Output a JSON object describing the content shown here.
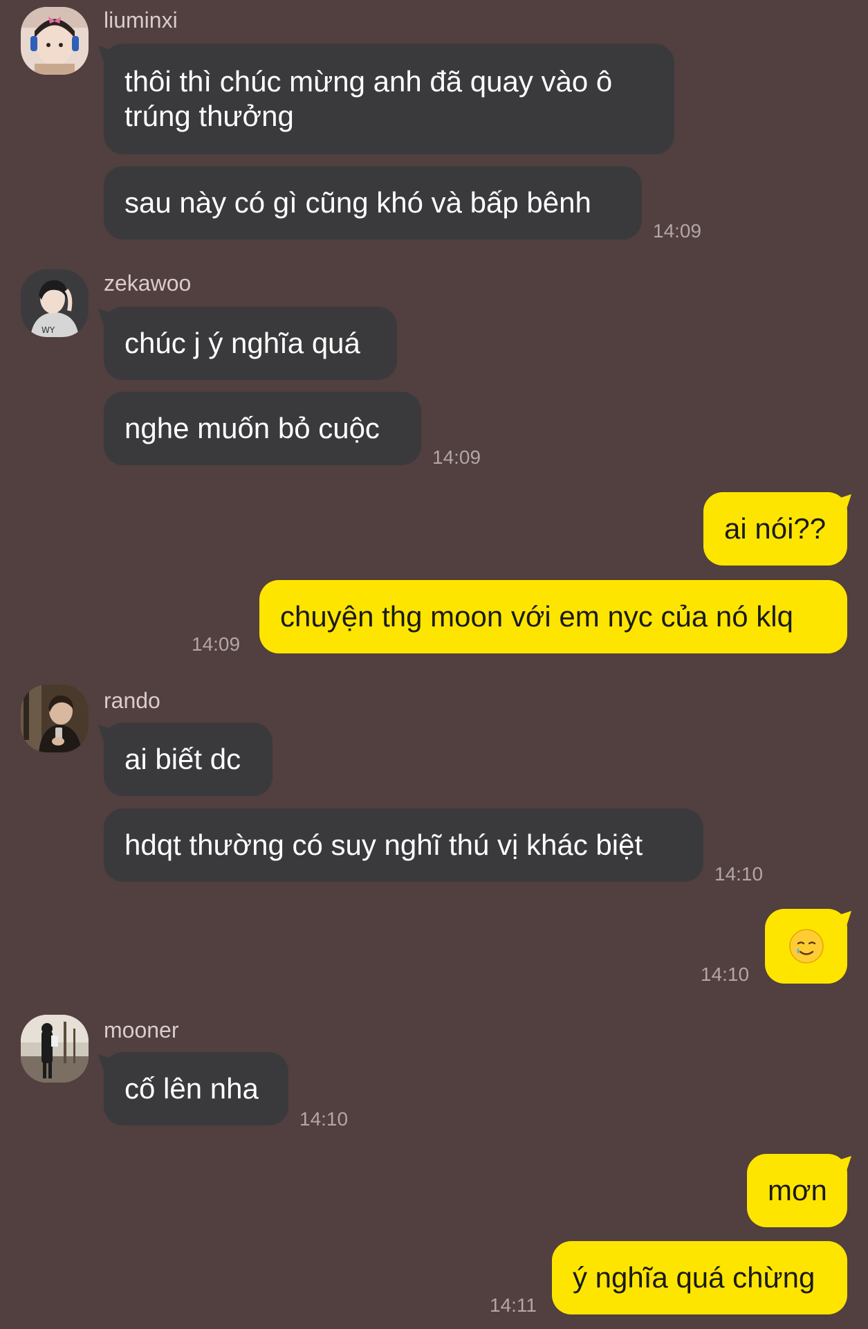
{
  "messages": {
    "g1": {
      "sender": "liuminxi",
      "m1": "thôi thì chúc mừng anh đã quay vào ô trúng thưởng",
      "m2": "sau này có gì cũng khó và bấp bênh",
      "time": "14:09"
    },
    "g2": {
      "sender": "zekawoo",
      "m1": "chúc j ý nghĩa quá",
      "m2": "nghe muốn bỏ cuộc",
      "time": "14:09"
    },
    "g3": {
      "m1": "ai nói??",
      "m2": "chuyện thg moon với em nyc của nó klq",
      "time": "14:09"
    },
    "g4": {
      "sender": "rando",
      "m1": "ai biết dc",
      "m2": "hdqt thường có suy nghĩ thú vị khác biệt",
      "time": "14:10"
    },
    "g5": {
      "m1": "🥲",
      "time": "14:10"
    },
    "g6": {
      "sender": "mooner",
      "m1": "cố lên nha",
      "time": "14:10"
    },
    "g7": {
      "m1": "mơn",
      "m2": "ý nghĩa quá chừng",
      "time": "14:11"
    }
  },
  "colors": {
    "background": "#523f3f",
    "incoming_bubble": "#3a3a3c",
    "outgoing_bubble": "#fee500"
  }
}
